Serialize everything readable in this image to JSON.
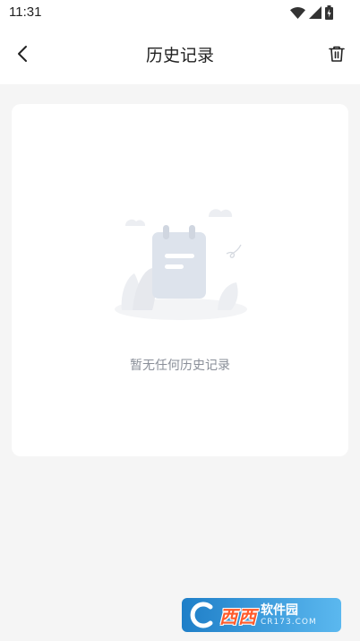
{
  "status_bar": {
    "time": "11:31",
    "icons": [
      "wifi-icon",
      "signal-icon",
      "battery-icon"
    ]
  },
  "header": {
    "title": "历史记录",
    "back_icon": "chevron-left-icon",
    "delete_icon": "trash-icon"
  },
  "empty_state": {
    "illustration": "notepad-illustration",
    "message": "暂无任何历史记录"
  },
  "watermark": {
    "main": "西西",
    "brand": "软件园",
    "domain": "CR173.COM"
  },
  "colors": {
    "page_bg": "#f5f5f5",
    "card_bg": "#ffffff",
    "empty_text": "#8a8f99",
    "watermark_bg": "#2f8fd6",
    "watermark_text": "#ff5a2a"
  }
}
